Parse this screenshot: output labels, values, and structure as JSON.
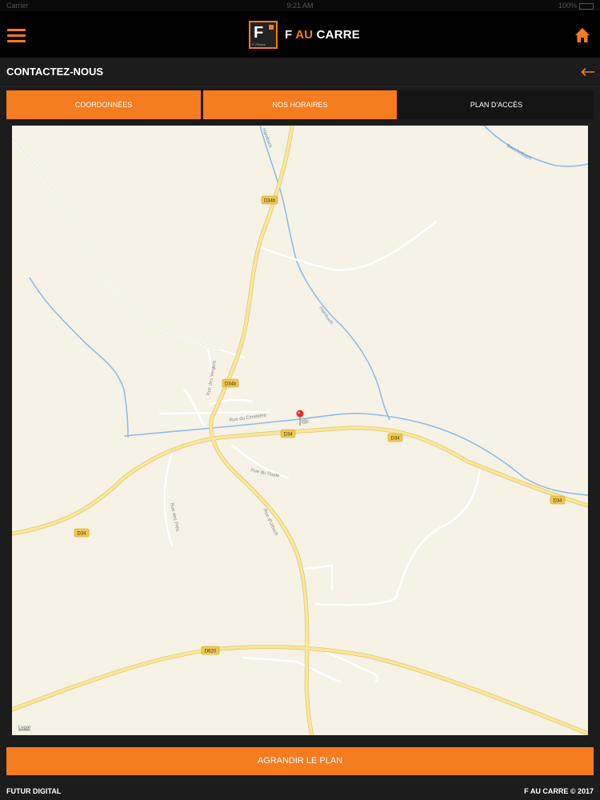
{
  "status_bar": {
    "left": "Carrier",
    "time": "9:21 AM",
    "battery": "100%"
  },
  "header": {
    "brand_prefix": "F ",
    "brand_accent": "AU",
    "brand_suffix": " CARRE",
    "logo_letter": "F",
    "logo_tagline": "F' Photos",
    "menu_icon": "hamburger-icon",
    "home_icon": "home-icon"
  },
  "page": {
    "title": "CONTACTEZ-NOUS",
    "back_icon": "arrow-left-icon"
  },
  "tabs": [
    {
      "label": "COORDONNÉES",
      "active": false
    },
    {
      "label": "NOS HORAIRES",
      "active": false
    },
    {
      "label": "PLAN D'ACCÈS",
      "active": true
    }
  ],
  "map": {
    "road_badges": [
      "D34b",
      "D34b",
      "D34",
      "D34",
      "D34",
      "D34",
      "D620"
    ],
    "street_labels": [
      "Rue du Cimetière",
      "Rue des Vergers",
      "Rue des Prés",
      "Rue du Stade",
      "Rue d'Urbach"
    ],
    "water_labels": [
      "Hambach",
      "Hambach",
      "Beechelbach"
    ],
    "legal": "Legal"
  },
  "actions": {
    "enlarge_label": "AGRANDIR LE PLAN"
  },
  "footer": {
    "left": "FUTUR DIGITAL",
    "right": "F AU CARRE © 2017"
  },
  "colors": {
    "accent": "#f57c1f",
    "background": "#1c1c1c",
    "map_land": "#f6f2e6",
    "road": "#f5dc7a",
    "water": "#8fbde6"
  }
}
